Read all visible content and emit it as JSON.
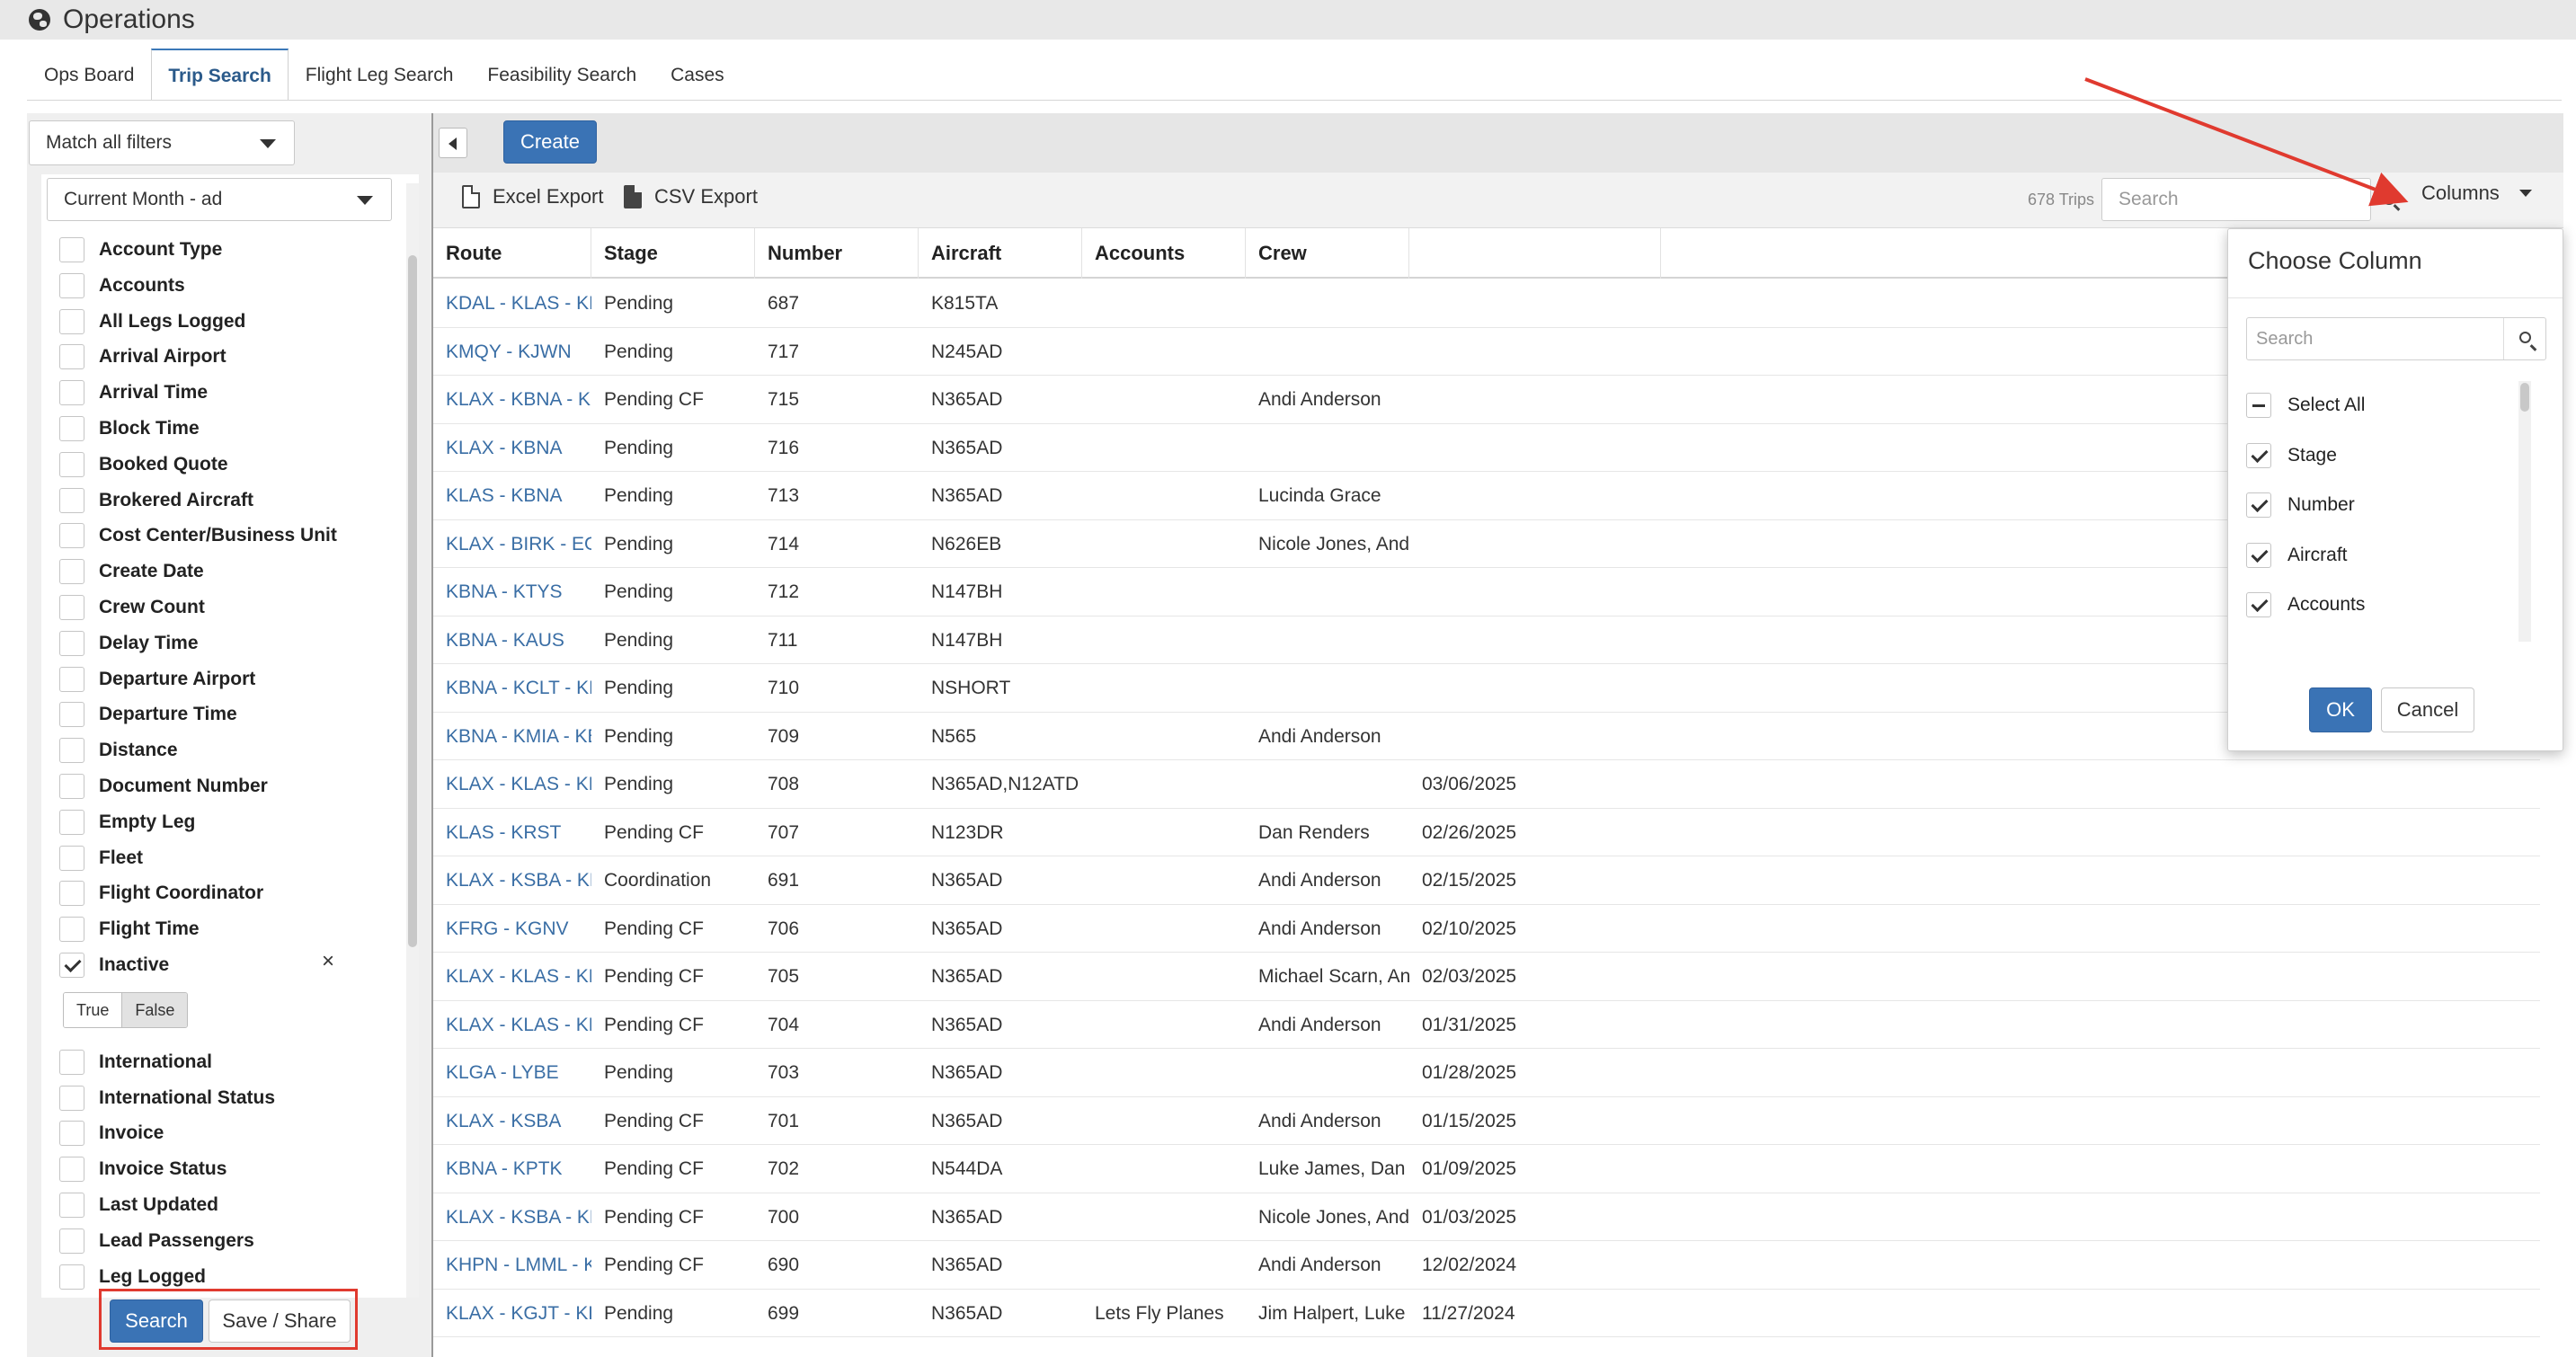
{
  "app": {
    "title": "Operations"
  },
  "tabs": [
    {
      "label": "Ops Board"
    },
    {
      "label": "Trip Search"
    },
    {
      "label": "Flight Leg Search"
    },
    {
      "label": "Feasibility Search"
    },
    {
      "label": "Cases"
    }
  ],
  "sidebar": {
    "match_select": "Match all filters",
    "date_select": "Current Month - ad",
    "filters": [
      {
        "label": "Account Type",
        "checked": false
      },
      {
        "label": "Accounts",
        "checked": false
      },
      {
        "label": "All Legs Logged",
        "checked": false
      },
      {
        "label": "Arrival Airport",
        "checked": false
      },
      {
        "label": "Arrival Time",
        "checked": false
      },
      {
        "label": "Block Time",
        "checked": false
      },
      {
        "label": "Booked Quote",
        "checked": false
      },
      {
        "label": "Brokered Aircraft",
        "checked": false
      },
      {
        "label": "Cost Center/Business Unit",
        "checked": false
      },
      {
        "label": "Create Date",
        "checked": false
      },
      {
        "label": "Crew Count",
        "checked": false
      },
      {
        "label": "Delay Time",
        "checked": false
      },
      {
        "label": "Departure Airport",
        "checked": false
      },
      {
        "label": "Departure Time",
        "checked": false
      },
      {
        "label": "Distance",
        "checked": false
      },
      {
        "label": "Document Number",
        "checked": false
      },
      {
        "label": "Empty Leg",
        "checked": false
      },
      {
        "label": "Fleet",
        "checked": false
      },
      {
        "label": "Flight Coordinator",
        "checked": false
      },
      {
        "label": "Flight Time",
        "checked": false
      },
      {
        "label": "Inactive",
        "checked": true
      },
      {
        "label": "International",
        "checked": false
      },
      {
        "label": "International Status",
        "checked": false
      },
      {
        "label": "Invoice",
        "checked": false
      },
      {
        "label": "Invoice Status",
        "checked": false
      },
      {
        "label": "Last Updated",
        "checked": false
      },
      {
        "label": "Lead Passengers",
        "checked": false
      },
      {
        "label": "Leg Logged",
        "checked": false
      }
    ],
    "inactive_toggle": {
      "true_label": "True",
      "false_label": "False",
      "selected": "False"
    },
    "clear_symbol": "×",
    "search_button": "Search",
    "save_share_button": "Save / Share"
  },
  "toolbar": {
    "create_button": "Create",
    "excel_export": "Excel Export",
    "csv_export": "CSV Export",
    "trip_count": "678 Trips",
    "search_placeholder": "Search",
    "columns_button": "Columns"
  },
  "table": {
    "columns": [
      "Route",
      "Stage",
      "Number",
      "Aircraft",
      "Accounts",
      "Crew",
      ""
    ],
    "rows": [
      [
        "KDAL - KLAS - KDAL",
        "Pending",
        "687",
        "K815TA",
        "",
        "",
        ""
      ],
      [
        "KMQY - KJWN",
        "Pending",
        "717",
        "N245AD",
        "",
        "",
        ""
      ],
      [
        "KLAX - KBNA - KCLT - KMIA - K...",
        "Pending CF",
        "715",
        "N365AD",
        "",
        "Andi Anderson",
        ""
      ],
      [
        "KLAX - KBNA",
        "Pending",
        "716",
        "N365AD",
        "",
        "",
        ""
      ],
      [
        "KLAS - KBNA",
        "Pending",
        "713",
        "N365AD",
        "",
        "Lucinda Grace",
        ""
      ],
      [
        "KLAX - BIRK - EGGW",
        "Pending",
        "714",
        "N626EB",
        "",
        "Nicole Jones, Andi Anderson",
        ""
      ],
      [
        "KBNA - KTYS",
        "Pending",
        "712",
        "N147BH",
        "",
        "",
        ""
      ],
      [
        "KBNA - KAUS",
        "Pending",
        "711",
        "N147BH",
        "",
        "",
        ""
      ],
      [
        "KBNA - KCLT - KBNA",
        "Pending",
        "710",
        "NSHORT",
        "",
        "",
        ""
      ],
      [
        "KBNA - KMIA - KBNA",
        "Pending",
        "709",
        "N565",
        "",
        "Andi Anderson",
        ""
      ],
      [
        "KLAX - KLAS - KDEN - KLAX",
        "Pending",
        "708",
        "N365AD,N12ATD",
        "",
        "",
        "03/06/2025"
      ],
      [
        "KLAS - KRST",
        "Pending CF",
        "707",
        "N123DR",
        "",
        "Dan Renders",
        "02/26/2025"
      ],
      [
        "KLAX - KSBA - KDEN",
        "Coordination",
        "691",
        "N365AD",
        "",
        "Andi Anderson",
        "02/15/2025"
      ],
      [
        "KFRG - KGNV",
        "Pending CF",
        "706",
        "N365AD",
        "",
        "Andi Anderson",
        "02/10/2025"
      ],
      [
        "KLAX - KLAS - KDAL",
        "Pending CF",
        "705",
        "N365AD",
        "",
        "Michael Scarn, Andi Anderson",
        "02/03/2025"
      ],
      [
        "KLAX - KLAS - KDAL",
        "Pending CF",
        "704",
        "N365AD",
        "",
        "Andi Anderson",
        "01/31/2025"
      ],
      [
        "KLGA - LYBE",
        "Pending",
        "703",
        "N365AD",
        "",
        "",
        "01/28/2025"
      ],
      [
        "KLAX - KSBA",
        "Pending CF",
        "701",
        "N365AD",
        "",
        "Andi Anderson",
        "01/15/2025"
      ],
      [
        "KBNA - KPTK",
        "Pending CF",
        "702",
        "N544DA",
        "",
        "Luke James, Dan Renders",
        "01/09/2025"
      ],
      [
        "KLAX - KSBA - KLAS - KDEN - K...",
        "Pending CF",
        "700",
        "N365AD",
        "",
        "Nicole Jones, Andi Anderson",
        "01/03/2025"
      ],
      [
        "KHPN - LMML - KHPN",
        "Pending CF",
        "690",
        "N365AD",
        "",
        "Andi Anderson",
        "12/02/2024"
      ],
      [
        "KLAX - KGJT - KLAS",
        "Pending",
        "699",
        "N365AD",
        "Lets Fly Planes",
        "Jim Halpert, Luke James",
        "11/27/2024"
      ]
    ]
  },
  "column_chooser": {
    "title": "Choose Column",
    "search_placeholder": "Search",
    "items": [
      {
        "label": "Select All",
        "state": "indeterminate"
      },
      {
        "label": "Stage",
        "state": "checked"
      },
      {
        "label": "Number",
        "state": "checked"
      },
      {
        "label": "Aircraft",
        "state": "checked"
      },
      {
        "label": "Accounts",
        "state": "checked"
      }
    ],
    "ok_button": "OK",
    "cancel_button": "Cancel"
  },
  "colors": {
    "primary": "#3a73b5",
    "link": "#3a6ea5",
    "annotation": "#e03a2f"
  }
}
